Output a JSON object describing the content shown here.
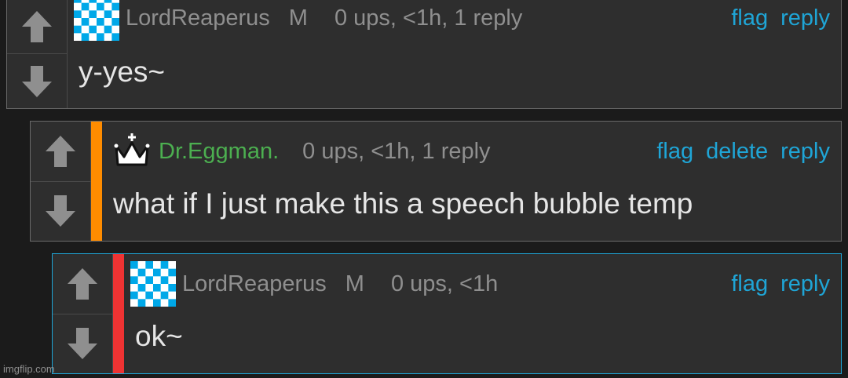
{
  "comments": [
    {
      "username": "LordReaperus",
      "gender": "M",
      "meta": "0 ups, <1h, 1 reply",
      "text": "y-yes~",
      "actions": [
        "flag",
        "reply"
      ],
      "avatar_icon": "checker-avatar-icon",
      "accent_color": null
    },
    {
      "username": "Dr.Eggman.",
      "gender": "",
      "meta": "0 ups, <1h, 1 reply",
      "text": "what if I just make this a speech bubble temp",
      "actions": [
        "flag",
        "delete",
        "reply"
      ],
      "avatar_icon": "crown-icon",
      "accent_color": "#ff8c00"
    },
    {
      "username": "LordReaperus",
      "gender": "M",
      "meta": "0 ups, <1h",
      "text": "ok~",
      "actions": [
        "flag",
        "reply"
      ],
      "avatar_icon": "checker-avatar-icon",
      "accent_color": "#ee3333"
    }
  ],
  "watermark": "imgflip.com",
  "colors": {
    "link": "#1fa5d6",
    "username_mod": "#4caf50",
    "background": "#1b1b1b",
    "panel": "#2e2e2e"
  }
}
